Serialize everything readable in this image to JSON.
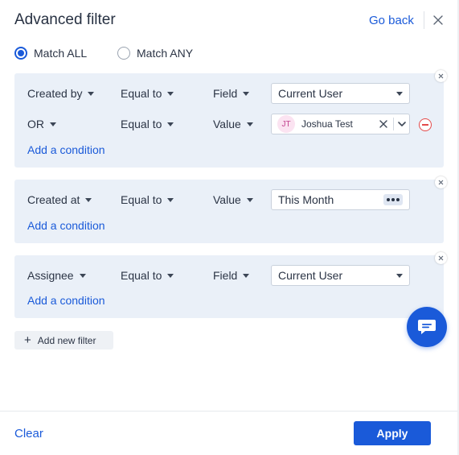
{
  "header": {
    "title": "Advanced filter",
    "go_back": "Go back"
  },
  "match": {
    "all_label": "Match ALL",
    "any_label": "Match ANY",
    "selected": "all"
  },
  "groups": [
    {
      "conditions": [
        {
          "field": "Created by",
          "operator": "Equal to",
          "value_type": "Field",
          "value": "Current User"
        },
        {
          "field": "OR",
          "operator": "Equal to",
          "value_type": "Value",
          "chip_initials": "JT",
          "chip_name": "Joshua Test"
        }
      ],
      "add_condition": "Add a condition"
    },
    {
      "conditions": [
        {
          "field": "Created at",
          "operator": "Equal to",
          "value_type": "Value",
          "value": "This Month"
        }
      ],
      "add_condition": "Add a condition"
    },
    {
      "conditions": [
        {
          "field": "Assignee",
          "operator": "Equal to",
          "value_type": "Field",
          "value": "Current User"
        }
      ],
      "add_condition": "Add a condition"
    }
  ],
  "add_new_filter": "Add new filter",
  "footer": {
    "clear": "Clear",
    "apply": "Apply"
  },
  "colors": {
    "accent": "#1a5ad9",
    "group_bg": "#eaf0f8",
    "danger": "#e34a4a"
  },
  "icons": {
    "close": "close-icon",
    "caret": "caret-down-icon",
    "remove": "minus-circle-icon",
    "chat": "chat-icon",
    "more": "more-horizontal-icon"
  }
}
